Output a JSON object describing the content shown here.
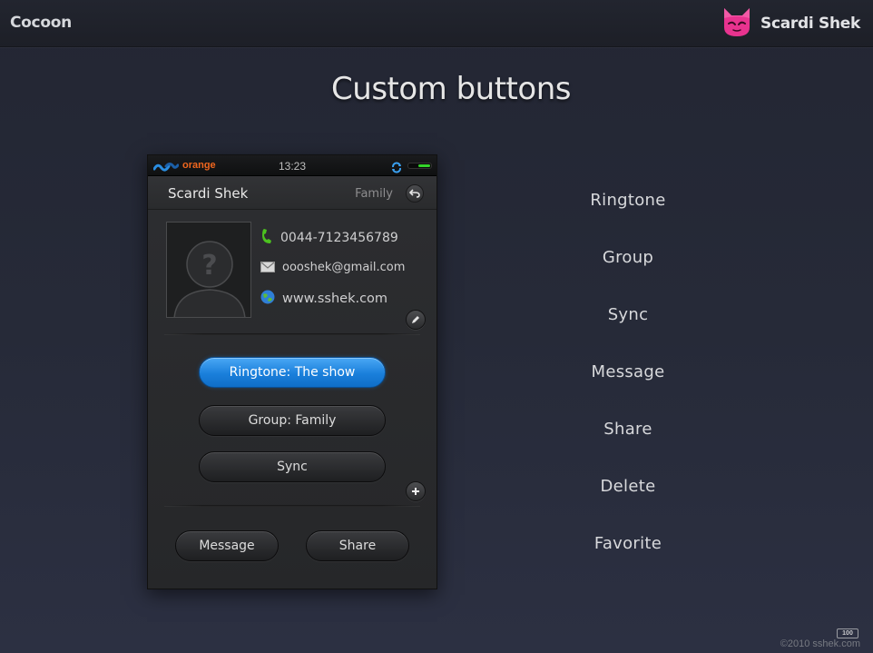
{
  "header": {
    "brand_left": "Cocoon",
    "author": "Scardi Shek",
    "author_icon": "cat-face-icon"
  },
  "page_title": "Custom buttons",
  "phone": {
    "status": {
      "carrier": "orange",
      "time": "13:23",
      "carrier_icon": "wave-logo-icon",
      "sync_icon": "sync-icon",
      "battery_icon": "battery-icon"
    },
    "contact": {
      "name": "Scardi Shek",
      "group": "Family",
      "phone": "0044-7123456789",
      "email": "oooshek@gmail.com",
      "website": "www.sshek.com"
    },
    "buttons": {
      "ringtone": "Ringtone: The show",
      "group": "Group: Family",
      "sync": "Sync",
      "message": "Message",
      "share": "Share"
    }
  },
  "labels": [
    "Ringtone",
    "Group",
    "Sync",
    "Message",
    "Share",
    "Delete",
    "Favorite"
  ],
  "footer": {
    "copyright": "©2010 sshek.com",
    "badge": "100"
  },
  "colors": {
    "accent_blue": "#1a7fdb",
    "carrier_orange": "#f0661e",
    "brand_pink": "#e8338f",
    "phone_green": "#4cc21f"
  }
}
